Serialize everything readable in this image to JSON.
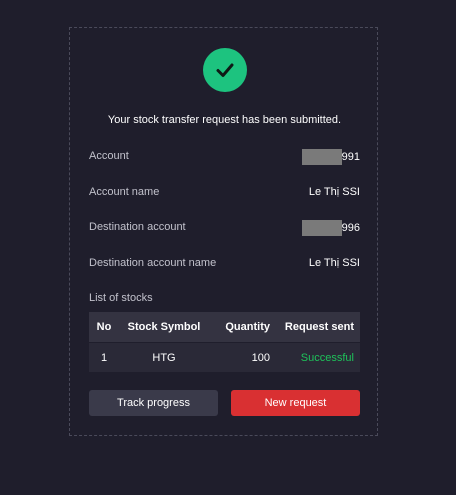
{
  "success": {
    "message": "Your stock transfer request has been submitted."
  },
  "details": {
    "account_label": "Account",
    "account_value": "991",
    "account_name_label": "Account name",
    "account_name_value": "Le Thị SSI",
    "destination_account_label": "Destination account",
    "destination_account_value": "996",
    "destination_account_name_label": "Destination account name",
    "destination_account_name_value": "Le Thị SSI"
  },
  "stocks": {
    "title": "List of stocks",
    "headers": {
      "no": "No",
      "symbol": "Stock Symbol",
      "quantity": "Quantity",
      "request_sent": "Request sent"
    },
    "rows": [
      {
        "no": "1",
        "symbol": "HTG",
        "quantity": "100",
        "request_sent": "Successful"
      }
    ]
  },
  "actions": {
    "track_label": "Track progress",
    "new_label": "New request"
  },
  "colors": {
    "background": "#1f1e2c",
    "success_green": "#1dc37f",
    "status_green": "#1ec25a",
    "primary_red": "#d93032",
    "secondary_button": "#3a3a4a"
  },
  "icons": {
    "success": "check-circle-icon"
  }
}
